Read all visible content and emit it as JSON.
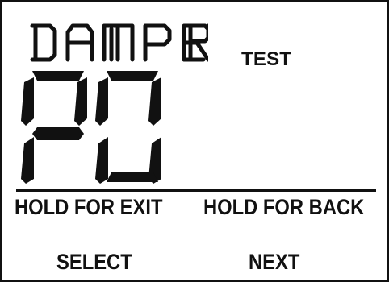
{
  "display": {
    "top_label": "DAMPER",
    "main_code": "P0",
    "mode": "TEST"
  },
  "soft_keys": {
    "upper_left": "HOLD FOR EXIT",
    "upper_right": "HOLD FOR BACK",
    "lower_left": "SELECT",
    "lower_right": "NEXT"
  },
  "colors": {
    "foreground": "#111111",
    "background": "#ffffff"
  }
}
